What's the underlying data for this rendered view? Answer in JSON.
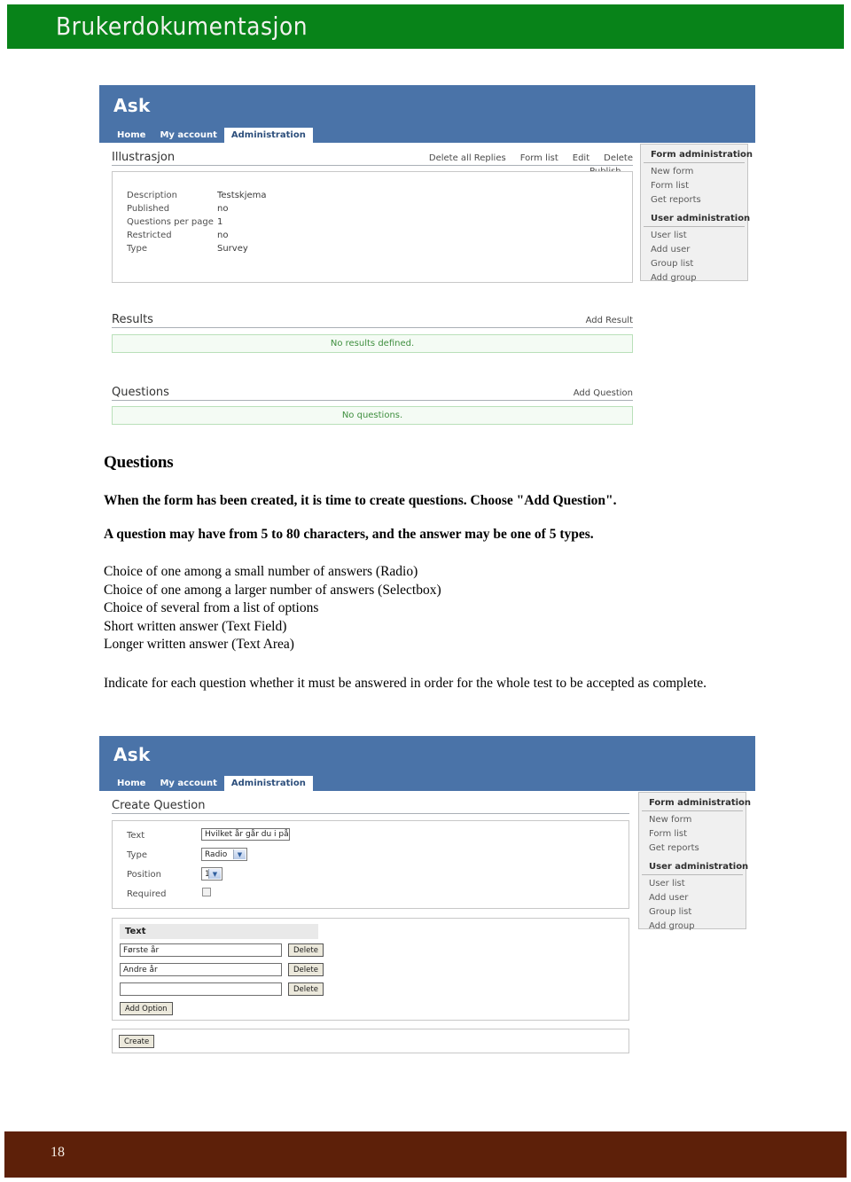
{
  "document": {
    "banner_title": "Brukerdokumentasjon",
    "page_number": "18",
    "banner_color": "#088319",
    "footer_color": "#5d2009"
  },
  "screenshot_one": {
    "app_name": "Ask",
    "accent_color": "#4a73a8",
    "tabs": [
      {
        "label": "Home",
        "active": false
      },
      {
        "label": "My account",
        "active": false
      },
      {
        "label": "Administration",
        "active": true
      }
    ],
    "form": {
      "title": "Illustrasjon",
      "actions": [
        "Delete all Replies",
        "Form list",
        "Edit",
        "Delete"
      ],
      "publish_link": "Publish",
      "details": [
        {
          "key": "Description",
          "value": "Testskjema"
        },
        {
          "key": "Published",
          "value": "no"
        },
        {
          "key": "Questions per page",
          "value": "1"
        },
        {
          "key": "Restricted",
          "value": "no"
        },
        {
          "key": "Type",
          "value": "Survey"
        }
      ]
    },
    "results": {
      "title": "Results",
      "action": "Add Result",
      "empty_message": "No results defined."
    },
    "questions": {
      "title": "Questions",
      "action": "Add Question",
      "empty_message": "No questions."
    },
    "sidebar": {
      "groups": [
        {
          "heading": "Form administration",
          "links": [
            "New form",
            "Form list",
            "Get reports"
          ]
        },
        {
          "heading": "User administration",
          "links": [
            "User list",
            "Add user",
            "Group list",
            "Add group"
          ]
        }
      ]
    }
  },
  "prose": {
    "heading": "Questions",
    "para1": "When the form has been created, it is time to create questions. Choose \"Add Question\".",
    "para2": "A question may have from 5 to 80 characters, and the answer may be one of 5 types.",
    "types": [
      "Choice of one among a small number of answers (Radio)",
      "Choice of one among a larger number of answers (Selectbox)",
      "Choice of several from a list of options",
      "Short written answer (Text Field)",
      "Longer written answer (Text Area)"
    ],
    "para3": "Indicate for each question whether it must be answered in order for the whole test to be accepted as complete."
  },
  "screenshot_two": {
    "app_name": "Ask",
    "accent_color": "#4a73a8",
    "tabs": [
      {
        "label": "Home",
        "active": false
      },
      {
        "label": "My account",
        "active": false
      },
      {
        "label": "Administration",
        "active": true
      }
    ],
    "page_title": "Create Question",
    "fields": {
      "text_label": "Text",
      "text_value": "Hvilket år går du i på",
      "type_label": "Type",
      "type_value": "Radio",
      "position_label": "Position",
      "position_value": "1",
      "required_label": "Required",
      "required_checked": false
    },
    "options_panel": {
      "column_header": "Text",
      "options": [
        {
          "value": "Første år",
          "delete_label": "Delete"
        },
        {
          "value": "Andre år",
          "delete_label": "Delete"
        },
        {
          "value": "",
          "delete_label": "Delete"
        }
      ],
      "add_option_label": "Add Option"
    },
    "create_label": "Create",
    "sidebar": {
      "groups": [
        {
          "heading": "Form administration",
          "links": [
            "New form",
            "Form list",
            "Get reports"
          ]
        },
        {
          "heading": "User administration",
          "links": [
            "User list",
            "Add user",
            "Group list",
            "Add group"
          ]
        }
      ]
    }
  }
}
